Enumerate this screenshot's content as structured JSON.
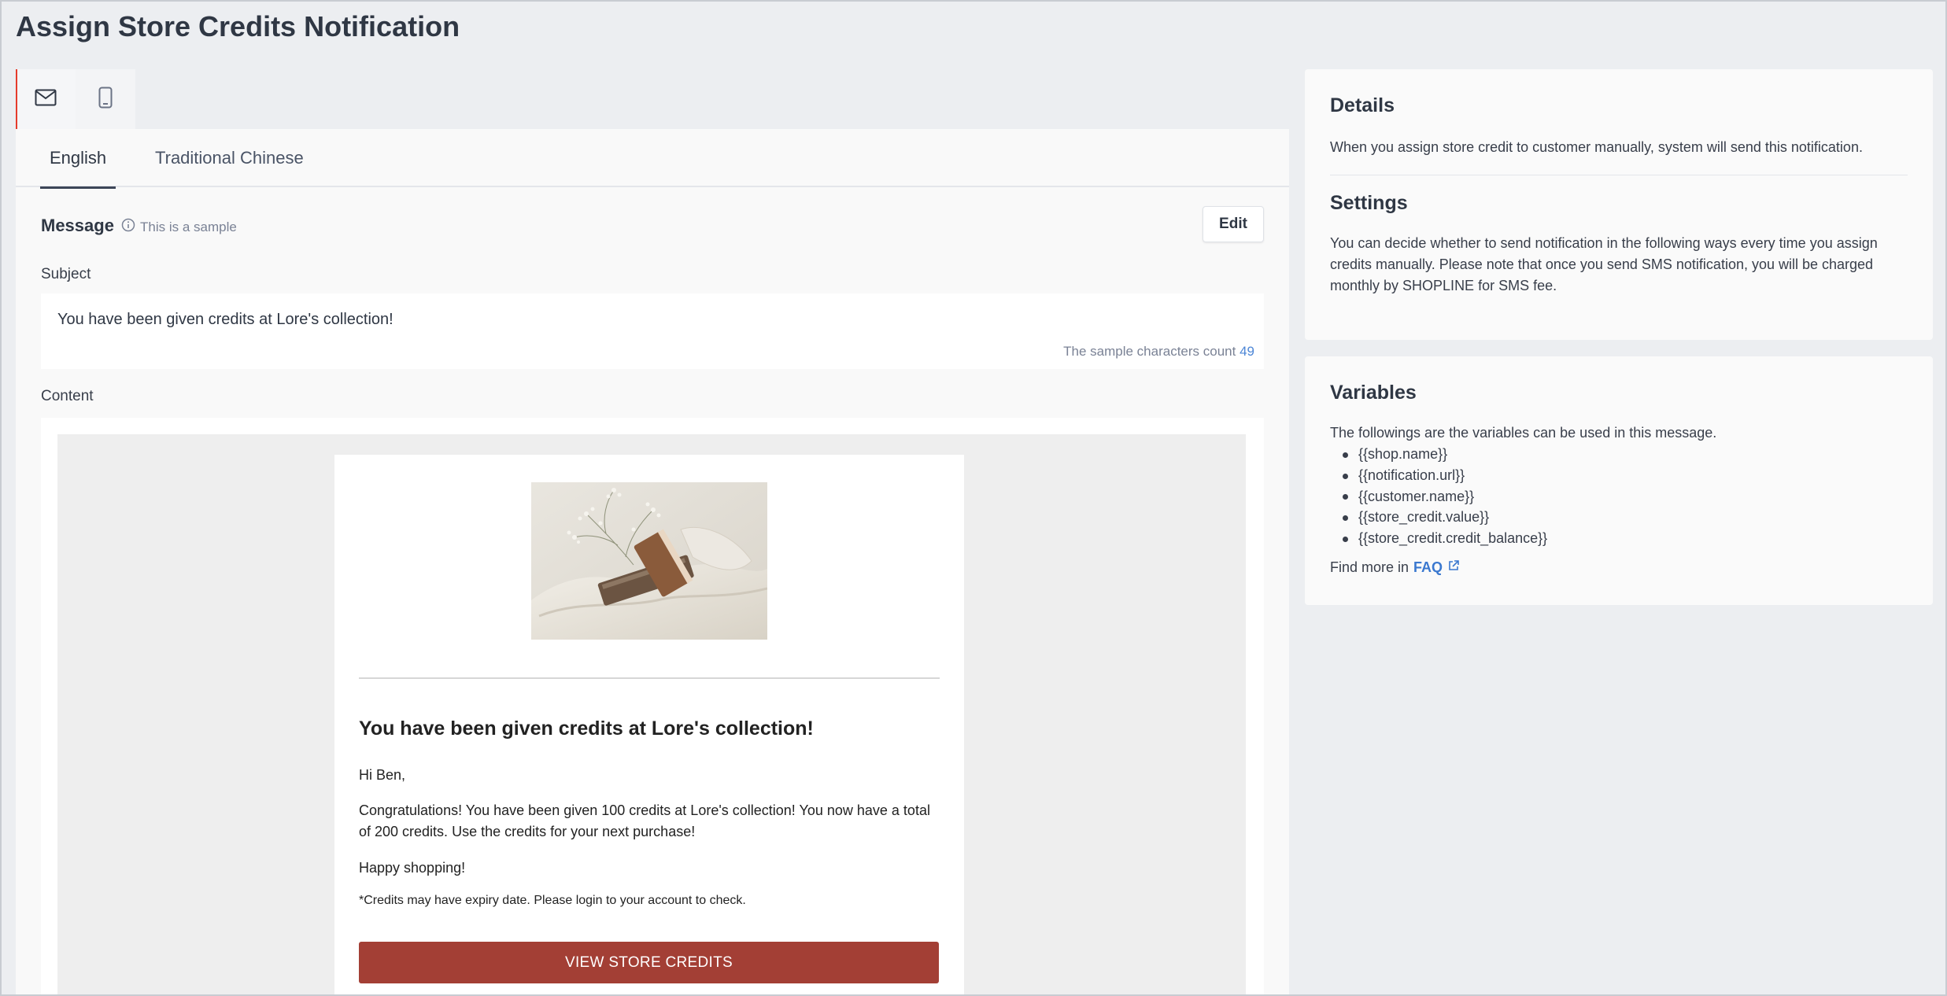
{
  "page": {
    "title": "Assign Store Credits Notification"
  },
  "channels": [
    {
      "icon": "mail-icon",
      "selected": true
    },
    {
      "icon": "mobile-phone-icon",
      "selected": false
    }
  ],
  "language_tabs": [
    {
      "label": "English",
      "active": true
    },
    {
      "label": "Traditional Chinese",
      "active": false
    }
  ],
  "message": {
    "label": "Message",
    "sample_note": "This is a sample",
    "edit_label": "Edit",
    "subject_label": "Subject",
    "subject_value": "You have been given credits at Lore's collection!",
    "char_count_label": "The sample characters count",
    "char_count_value": "49",
    "content_label": "Content"
  },
  "email_preview": {
    "heading": "You have been given credits at Lore's collection!",
    "greeting": "Hi Ben,",
    "body": "Congratulations! You have been given 100 credits at Lore's collection! You now have a total of 200 credits. Use the credits for your next purchase!",
    "signoff": "Happy shopping!",
    "footnote": "*Credits may have expiry date. Please login to your account to check.",
    "cta_label": "VIEW STORE CREDITS",
    "cta_color": "#a33f35"
  },
  "details": {
    "title": "Details",
    "text": "When you assign store credit to customer manually, system will send this notification.",
    "settings_title": "Settings",
    "settings_text": "You can decide whether to send notification in the following ways every time you assign credits manually. Please note that once you send SMS notification, you will be charged monthly by SHOPLINE for SMS fee."
  },
  "variables": {
    "title": "Variables",
    "intro": "The followings are the variables can be used in this message.",
    "items": [
      "{{shop.name}}",
      "{{notification.url}}",
      "{{customer.name}}",
      "{{store_credit.value}}",
      "{{store_credit.credit_balance}}"
    ],
    "find_more": "Find more in",
    "faq_label": "FAQ"
  },
  "colors": {
    "highlight": "#e53b2c",
    "link": "#3a78cf",
    "count": "#4c86d6"
  }
}
